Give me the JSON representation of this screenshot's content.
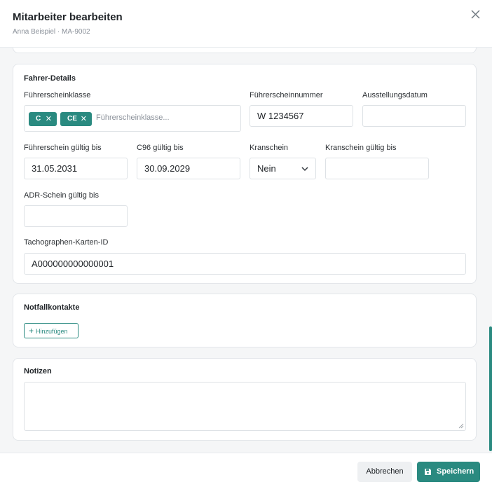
{
  "header": {
    "title": "Mitarbeiter bearbeiten",
    "subtitle": "Anna Beispiel · MA-9002"
  },
  "driver_details": {
    "title": "Fahrer-Details",
    "license_class": {
      "label": "Führerscheinklasse",
      "tags": [
        "C",
        "CE"
      ],
      "placeholder": "Führerscheinklasse..."
    },
    "license_number": {
      "label": "Führerscheinnummer",
      "value": "W 1234567"
    },
    "issue_date": {
      "label": "Ausstellungsdatum",
      "value": ""
    },
    "license_valid_until": {
      "label": "Führerschein gültig bis",
      "value": "31.05.2031"
    },
    "c96_valid_until": {
      "label": "C96 gültig bis",
      "value": "30.09.2029"
    },
    "crane_license": {
      "label": "Kranschein",
      "value": "Nein"
    },
    "crane_license_valid_until": {
      "label": "Kranschein gültig bis",
      "value": ""
    },
    "adr_valid_until": {
      "label": "ADR-Schein gültig bis",
      "value": ""
    },
    "tachograph_card_id": {
      "label": "Tachographen-Karten-ID",
      "value": "A000000000000001"
    }
  },
  "emergency_contacts": {
    "title": "Notfallkontakte",
    "add_label": "Hinzufügen"
  },
  "notes": {
    "title": "Notizen",
    "value": ""
  },
  "footer": {
    "cancel_label": "Abbrechen",
    "save_label": "Speichern"
  },
  "colors": {
    "accent": "#2a8a80",
    "background": "#f5f6f7",
    "border": "#dee2e6"
  },
  "icons": [
    "close-icon",
    "tag-remove-icon",
    "chevron-down-icon",
    "plus-icon",
    "resize-grip-icon",
    "save-icon"
  ]
}
